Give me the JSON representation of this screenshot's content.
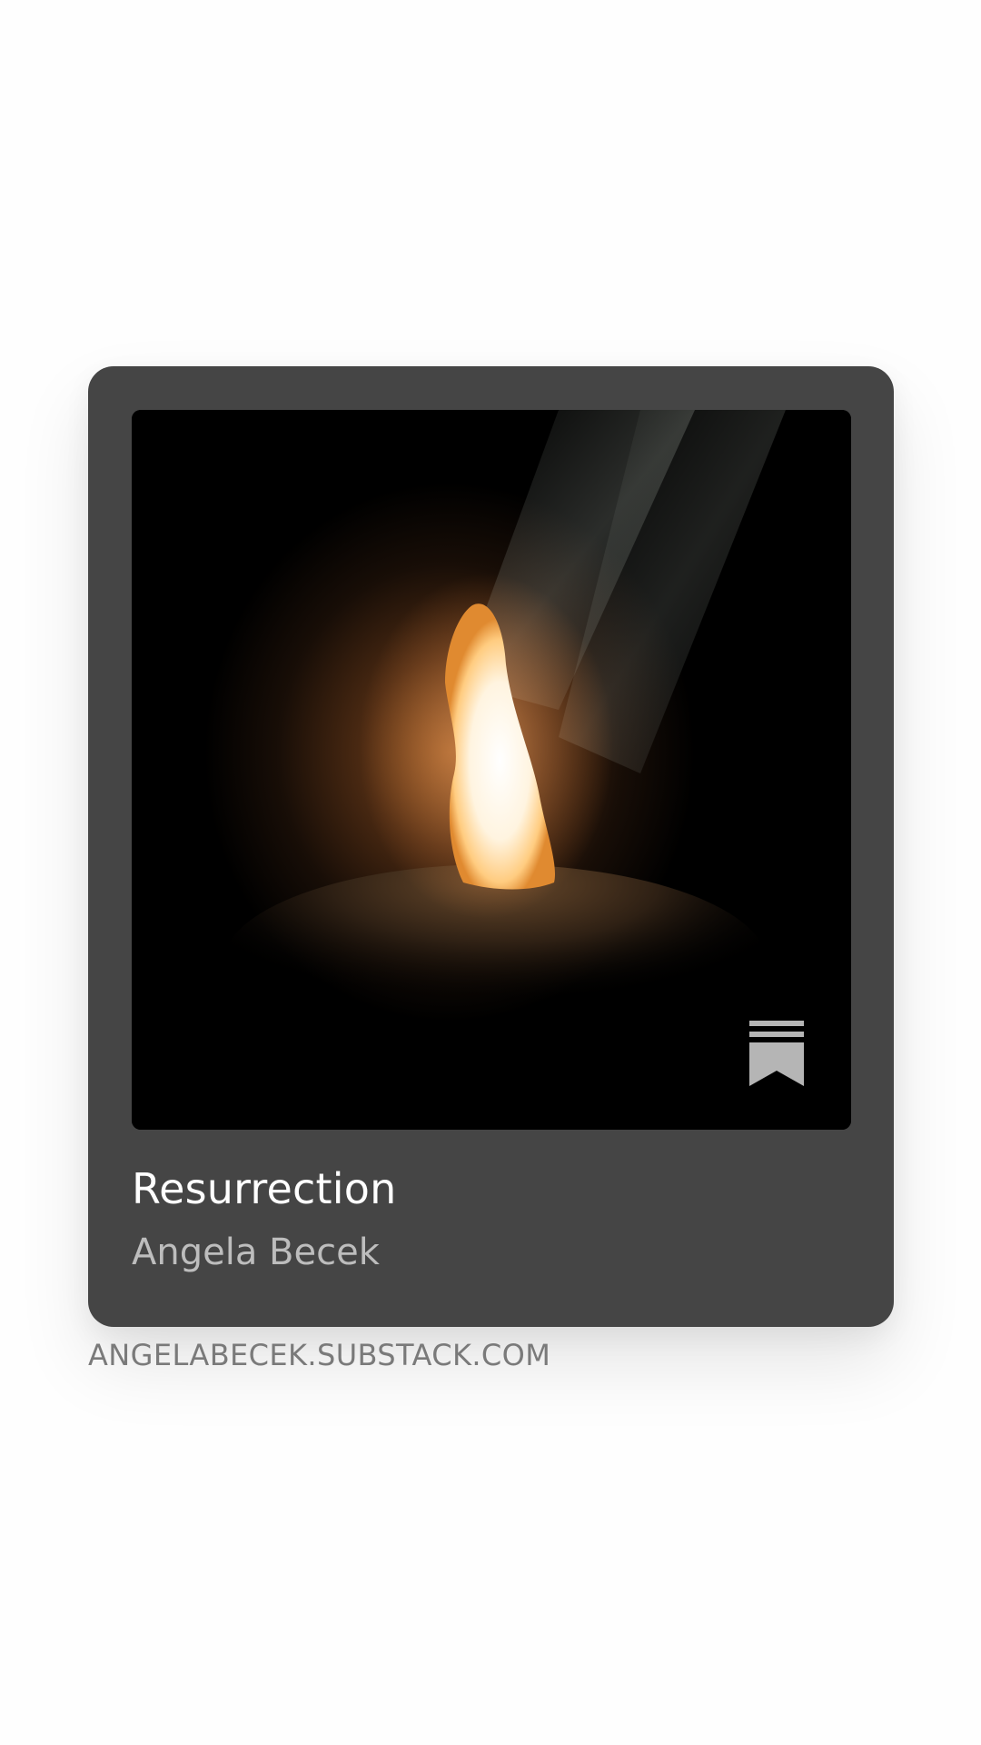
{
  "post": {
    "title": "Resurrection",
    "author": "Angela Becek",
    "domain": "ANGELABECEK.SUBSTACK.COM"
  },
  "cover": {
    "description_icon": "substack-bookmark-icon"
  },
  "colors": {
    "card_background": "#454545",
    "title": "#ffffff",
    "author": "#bdbdbd",
    "domain": "#7a7a7a",
    "page_background": "#fefefe"
  }
}
